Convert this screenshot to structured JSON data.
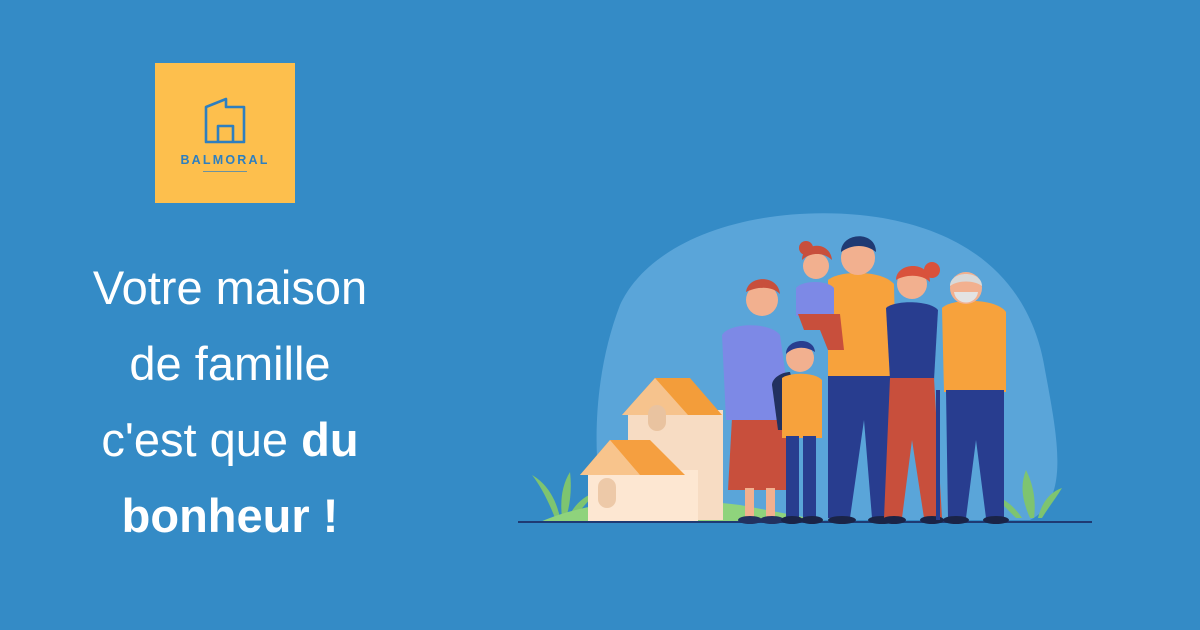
{
  "brand": {
    "name": "BALMORAL",
    "bg_color": "#fdbf4d",
    "icon": "house-icon"
  },
  "headline": {
    "line1": "Votre maison",
    "line2": "de famille",
    "line3_regular": "c'est que",
    "line3_bold": "du",
    "line4_bold": "bonheur !"
  },
  "illustration": {
    "subject": "family-in-front-of-house",
    "accent_colors": [
      "#f7a23c",
      "#c84f3c",
      "#283d8f",
      "#7d89e6",
      "#7ec470"
    ]
  },
  "colors": {
    "background": "#348bc6",
    "text": "#ffffff"
  }
}
